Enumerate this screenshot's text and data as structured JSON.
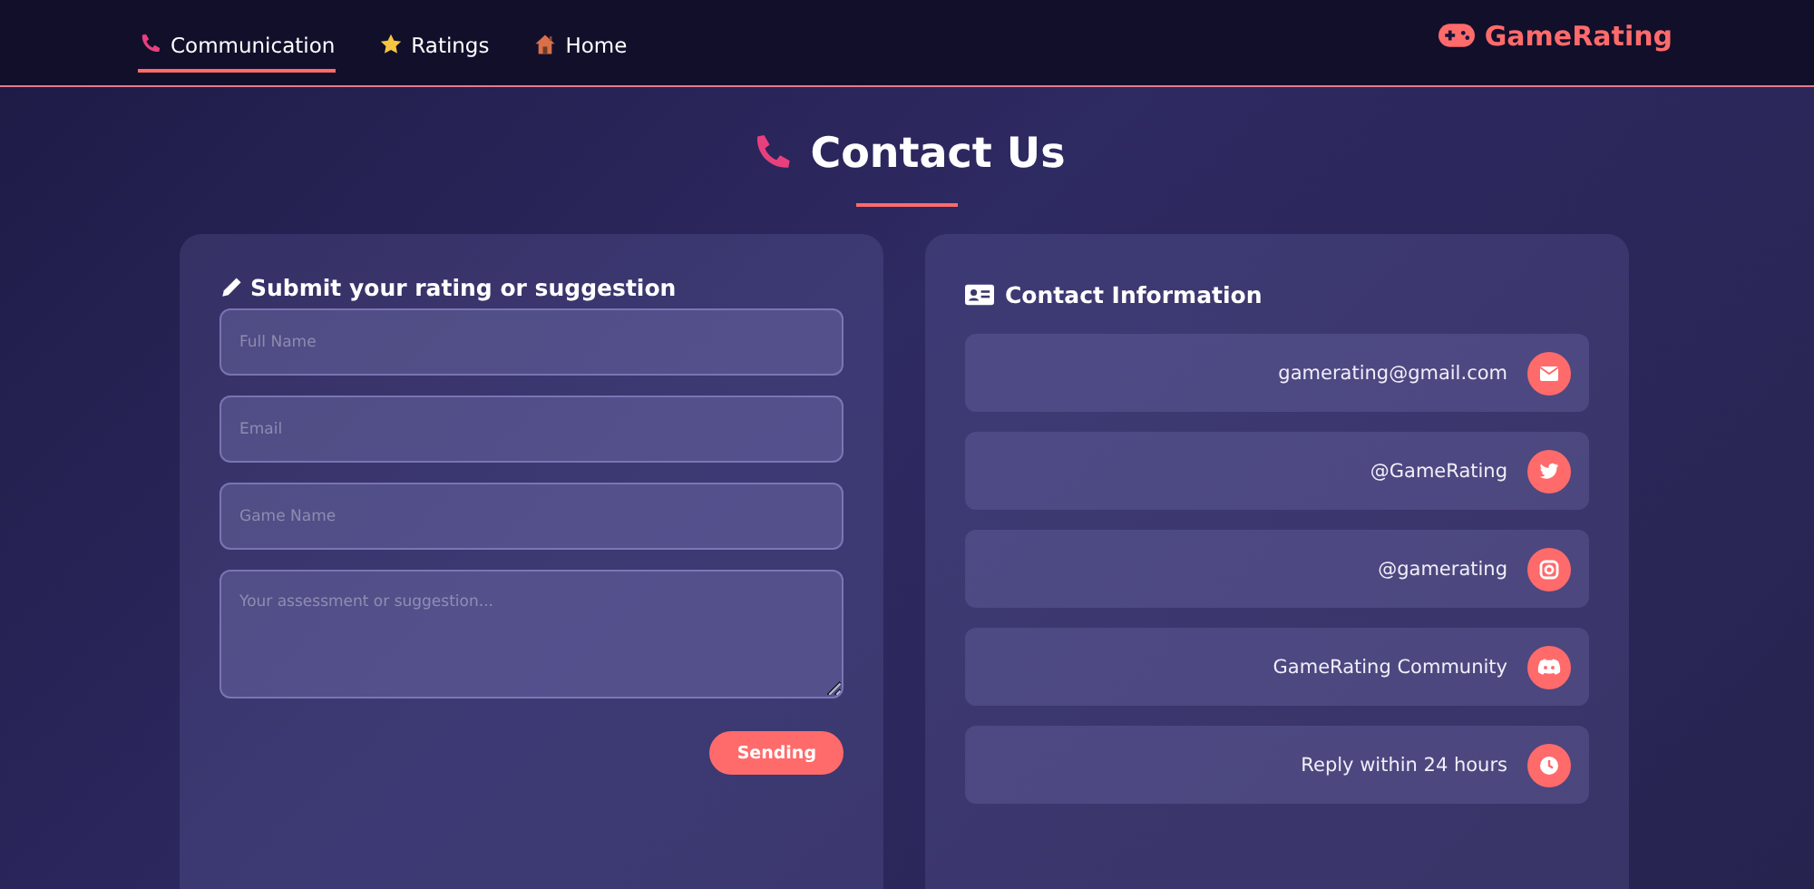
{
  "nav": {
    "items": [
      {
        "label": "Communication",
        "kind": "phone",
        "selected": true
      },
      {
        "label": "Ratings",
        "kind": "star",
        "selected": false
      },
      {
        "label": "Home",
        "kind": "house",
        "selected": false
      }
    ],
    "logo": "GameRating"
  },
  "page_title": "Contact Us",
  "form": {
    "title": "Submit your rating or suggestion",
    "fields": [
      {
        "placeholder": "Full Name",
        "kind": "input"
      },
      {
        "placeholder": "Email",
        "kind": "input"
      },
      {
        "placeholder": "Game Name",
        "kind": "input"
      },
      {
        "placeholder": "Your assessment or suggestion...",
        "kind": "textarea"
      }
    ],
    "submit": "Sending"
  },
  "contact": {
    "title": "Contact Information",
    "items": [
      {
        "text": "gamerating@gmail.com",
        "kind": "email"
      },
      {
        "text": "@GameRating",
        "kind": "twitter"
      },
      {
        "text": "@gamerating",
        "kind": "instagram"
      },
      {
        "text": "GameRating Community",
        "kind": "discord"
      },
      {
        "text": "Reply within 24 hours",
        "kind": "clock"
      }
    ]
  }
}
